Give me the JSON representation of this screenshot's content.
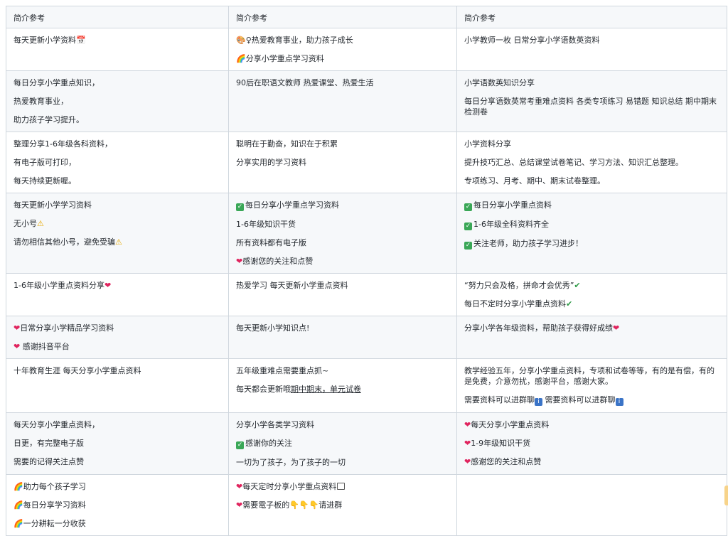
{
  "headers": [
    "简介参考",
    "简介参考",
    "简介参考"
  ],
  "rows": [
    {
      "c1": [
        "每天更新小学资料📅"
      ],
      "c2": [
        "🎨♀热爱教育事业，助力孩子成长",
        "🌈分享小学重点学习资料"
      ],
      "c3": [
        "小学教师一枚 日常分享小学语数英资料"
      ]
    },
    {
      "c1": [
        "每日分享小学重点知识，",
        "热爱教育事业，",
        "助力孩子学习提升。"
      ],
      "c2": [
        "90后在职语文教师 热爱课堂、热爱生活"
      ],
      "c3": [
        "小学语数英知识分享",
        "每日分享语数英常考重难点资料 各类专项练习 易错题 知识总结  期中期末检测卷"
      ]
    },
    {
      "c1": [
        "整理分享1-6年级各科资料，",
        "有电子版可打印，",
        "每天持续更新喔。"
      ],
      "c2": [
        "聪明在于勤奋，知识在于积累",
        "分享实用的学习资料"
      ],
      "c3": [
        "小学资料分享",
        "提升技巧汇总、总结课堂试卷笔记、学习方法、知识汇总整理。",
        "专项练习、月考、期中、期末试卷整理。"
      ]
    },
    {
      "c1": [
        "每天更新小学学习资料",
        " 无小号⚠",
        "请勿相信其他小号，避免受骗⚠"
      ],
      "c2": [
        "✅每日分享小学重点学习资料",
        "1-6年级知识干货",
        "所有资料都有电子版",
        "❤感谢您的关注和点赞"
      ],
      "c3": [
        "✅每日分享小学重点资料",
        "✅1-6年级全科资料齐全",
        " ✅关注老师，助力孩子学习进步！"
      ]
    },
    {
      "c1": [
        "1-6年级小学重点资料分享❤"
      ],
      "c2": [
        "热爱学习 每天更新小学重点资料"
      ],
      "c3": [
        "“努力只会及格，拼命才会优秀”✔",
        "每日不定时分享小学重点资料✔"
      ]
    },
    {
      "c1": [
        "❤日常分享小学精品学习资料",
        "❤ 感谢抖音平台"
      ],
      "c2": [
        "每天更新小学知识点!"
      ],
      "c3": [
        "分享小学各年级资料，帮助孩子获得好成绩❤"
      ]
    },
    {
      "c1": [
        "十年教育生涯 每天分享小学重点资料"
      ],
      "c2": [
        "五年级重难点需要重点抓~",
        "每天都会更新哦期中期末，单元试卷"
      ],
      "c3": [
        "教学经验五年，分享小学重点资料，专项和试卷等等，有的是有偿，有的是免费，介意勿扰，感谢平台，感谢大家。",
        " 需要资料可以进群聊ℹ 需要资料可以进群聊ℹ"
      ]
    },
    {
      "c1": [
        "每天分享小学重点资料，",
        "日更，有完整电子版",
        "需要的记得关注点赞"
      ],
      "c2": [
        "分享小学各类学习资料",
        "✅感谢你的关注",
        "一切为了孩子，为了孩子的一切"
      ],
      "c3": [
        "❤每天分享小学重点资料",
        "❤1-9年级知识干货",
        "❤感谢您的关注和点赞"
      ]
    },
    {
      "c1": [
        "🌈助力每个孩子学习",
        "🌈每日分享学习资料",
        "🌈一分耕耘一分收获"
      ],
      "c2": [
        "❤每天定时分享小学重点资料▢",
        "❤需要電子板的👇👇👇请进群"
      ],
      "c3": []
    }
  ]
}
